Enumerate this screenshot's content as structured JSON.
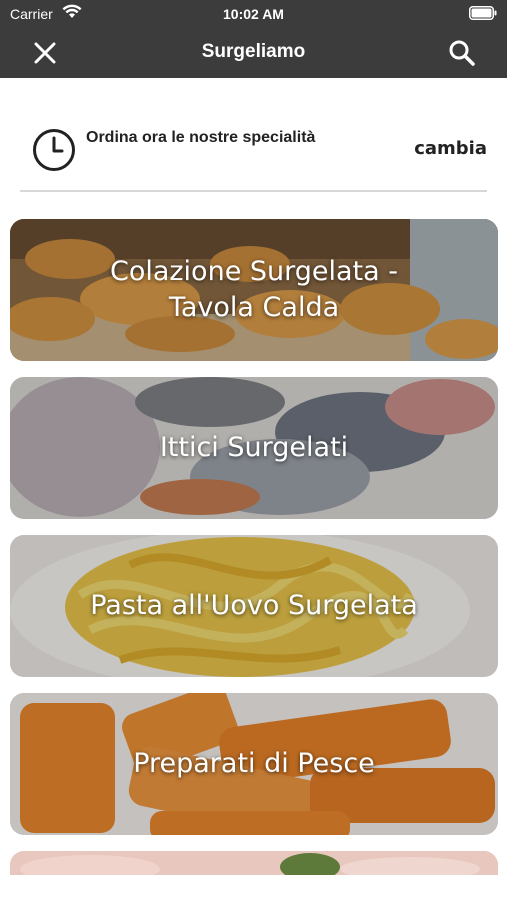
{
  "status_bar": {
    "carrier": "Carrier",
    "time": "10:02 AM"
  },
  "nav": {
    "title": "Surgeliamo",
    "close_icon": "close-icon",
    "search_icon": "search-icon"
  },
  "order": {
    "text": "Ordina ora le nostre specialità",
    "change_label": "cambia",
    "icon": "clock-icon"
  },
  "categories": [
    {
      "label": "Colazione Surgelata - Tavola Calda"
    },
    {
      "label": "Ittici Surgelati"
    },
    {
      "label": "Pasta all'Uovo Surgelata"
    },
    {
      "label": "Preparati di Pesce"
    },
    {
      "label": ""
    }
  ],
  "colors": {
    "bar_background": "#3c3c3c",
    "text_dark": "#222222",
    "divider": "#d8d8d8"
  }
}
